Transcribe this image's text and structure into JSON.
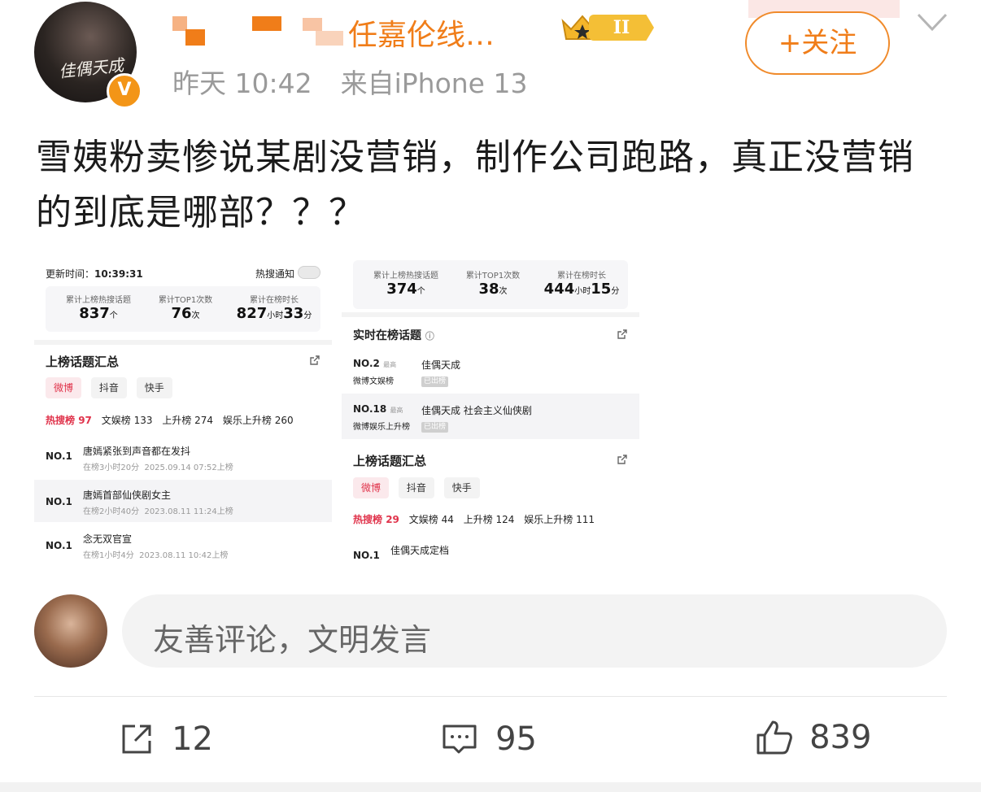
{
  "header": {
    "username_visible": "任嘉伦线…",
    "level_badge": "II",
    "timestamp": "昨天 10:42",
    "source": "来自iPhone 13",
    "follow_label": "+关注",
    "verified_mark": "V",
    "avatar_poster_title": "佳偶天成"
  },
  "post": {
    "text": "雪姨粉卖惨说某剧没营销，制作公司跑路，真正没营销的到底是哪部？？？"
  },
  "screenshot_left": {
    "update_label": "更新时间：",
    "update_time": "10:39:31",
    "hot_notify": "热搜通知",
    "stats": [
      {
        "label": "累计上榜热搜话题",
        "value": "837",
        "unit": "个"
      },
      {
        "label": "累计TOP1次数",
        "value": "76",
        "unit": "次"
      },
      {
        "label": "累计在榜时长",
        "value": "827",
        "unit": "小时",
        "value2": "33",
        "unit2": "分"
      }
    ],
    "section_title": "上榜话题汇总",
    "chips": [
      "微博",
      "抖音",
      "快手"
    ],
    "board_counts": [
      {
        "label": "热搜榜",
        "value": "97"
      },
      {
        "label": "文娱榜",
        "value": "133"
      },
      {
        "label": "上升榜",
        "value": "274"
      },
      {
        "label": "娱乐上升榜",
        "value": "260"
      }
    ],
    "rows": [
      {
        "rank": "NO.1",
        "title": "唐嫣紧张到声音都在发抖",
        "duration": "在榜3小时20分",
        "date": "2025.09.14 07:52上榜"
      },
      {
        "rank": "NO.1",
        "title": "唐嫣首部仙侠剧女主",
        "duration": "在榜2小时40分",
        "date": "2023.08.11 11:24上榜"
      },
      {
        "rank": "NO.1",
        "title": "念无双官宣",
        "duration": "在榜1小时4分",
        "date": "2023.08.11 10:42上榜"
      }
    ]
  },
  "screenshot_right": {
    "stats": [
      {
        "label": "累计上榜热搜话题",
        "value": "374",
        "unit": "个"
      },
      {
        "label": "累计TOP1次数",
        "value": "38",
        "unit": "次"
      },
      {
        "label": "累计在榜时长",
        "value": "444",
        "unit": "小时",
        "value2": "15",
        "unit2": "分"
      }
    ],
    "realtime_title": "实时在榜话题",
    "realtime_rows": [
      {
        "rank": "NO.2",
        "suffix": "最高",
        "board": "微博文娱榜",
        "title": "佳偶天成",
        "tag": "已出榜"
      },
      {
        "rank": "NO.18",
        "suffix": "最高",
        "board": "微博娱乐上升榜",
        "title": "佳偶天成 社会主义仙侠剧",
        "tag": "已出榜"
      }
    ],
    "section_title": "上榜话题汇总",
    "chips": [
      "微博",
      "抖音",
      "快手"
    ],
    "board_counts": [
      {
        "label": "热搜榜",
        "value": "29"
      },
      {
        "label": "文娱榜",
        "value": "44"
      },
      {
        "label": "上升榜",
        "value": "124"
      },
      {
        "label": "娱乐上升榜",
        "value": "111"
      }
    ],
    "last_row": {
      "rank": "NO.1",
      "title": "佳偶天成定档"
    }
  },
  "comment": {
    "placeholder": "友善评论，文明发言"
  },
  "actions": {
    "repost_count": "12",
    "comment_count": "95",
    "like_count": "839"
  },
  "colors": {
    "accent_orange": "#f07d19",
    "hot_red": "#e0334b",
    "meta_gray": "#9a9a9a"
  }
}
